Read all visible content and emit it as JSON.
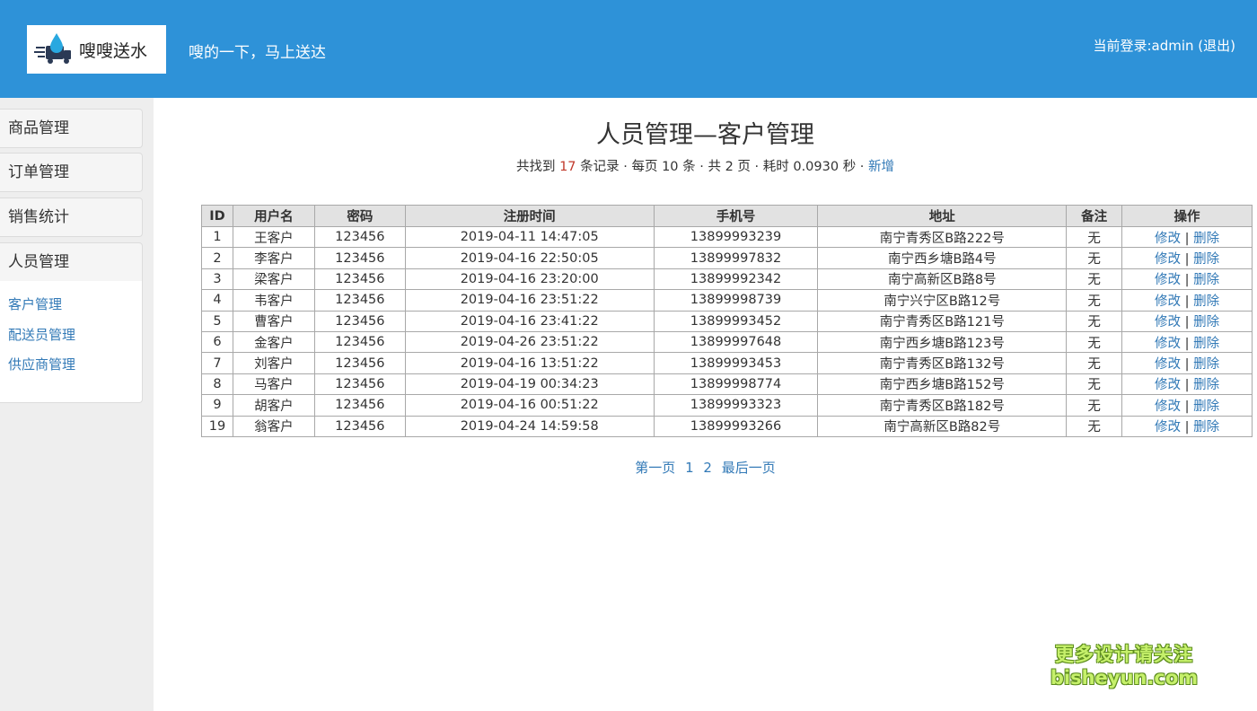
{
  "header": {
    "logo_text": "嗖嗖送水",
    "slogan": "嗖的一下，马上送达",
    "login_prefix": "当前登录:",
    "username": "admin",
    "logout": "(退出)"
  },
  "sidebar": {
    "menu": [
      "商品管理",
      "订单管理",
      "销售统计",
      "人员管理"
    ],
    "submenu": [
      "客户管理",
      "配送员管理",
      "供应商管理"
    ]
  },
  "main": {
    "title": "人员管理—客户管理",
    "summary": {
      "p1": "共找到 ",
      "count": "17",
      "p2": " 条记录 · 每页 10 条 · 共 2 页 · 耗时 0.0930 秒 · ",
      "add": "新增"
    },
    "table": {
      "headers": [
        "ID",
        "用户名",
        "密码",
        "注册时间",
        "手机号",
        "地址",
        "备注",
        "操作"
      ],
      "edit_label": "修改",
      "separator": "|",
      "delete_label": "删除",
      "rows": [
        [
          "1",
          "王客户",
          "123456",
          "2019-04-11 14:47:05",
          "13899993239",
          "南宁青秀区B路222号",
          "无"
        ],
        [
          "2",
          "李客户",
          "123456",
          "2019-04-16 22:50:05",
          "13899997832",
          "南宁西乡塘B路4号",
          "无"
        ],
        [
          "3",
          "梁客户",
          "123456",
          "2019-04-16 23:20:00",
          "13899992342",
          "南宁高新区B路8号",
          "无"
        ],
        [
          "4",
          "韦客户",
          "123456",
          "2019-04-16 23:51:22",
          "13899998739",
          "南宁兴宁区B路12号",
          "无"
        ],
        [
          "5",
          "曹客户",
          "123456",
          "2019-04-16 23:41:22",
          "13899993452",
          "南宁青秀区B路121号",
          "无"
        ],
        [
          "6",
          "金客户",
          "123456",
          "2019-04-26 23:51:22",
          "13899997648",
          "南宁西乡塘B路123号",
          "无"
        ],
        [
          "7",
          "刘客户",
          "123456",
          "2019-04-16 13:51:22",
          "13899993453",
          "南宁青秀区B路132号",
          "无"
        ],
        [
          "8",
          "马客户",
          "123456",
          "2019-04-19 00:34:23",
          "13899998774",
          "南宁西乡塘B路152号",
          "无"
        ],
        [
          "9",
          "胡客户",
          "123456",
          "2019-04-16 00:51:22",
          "13899993323",
          "南宁青秀区B路182号",
          "无"
        ],
        [
          "19",
          "翁客户",
          "123456",
          "2019-04-24 14:59:58",
          "13899993266",
          "南宁高新区B路82号",
          "无"
        ]
      ]
    },
    "pager": [
      "第一页",
      "1",
      "2",
      "最后一页"
    ]
  },
  "watermark": {
    "line1": "更多设计请关注",
    "line2": "bisheyun.com"
  },
  "colors": {
    "header_bg": "#2e92d8",
    "link": "#337ab7",
    "count_red": "#c0392b"
  }
}
